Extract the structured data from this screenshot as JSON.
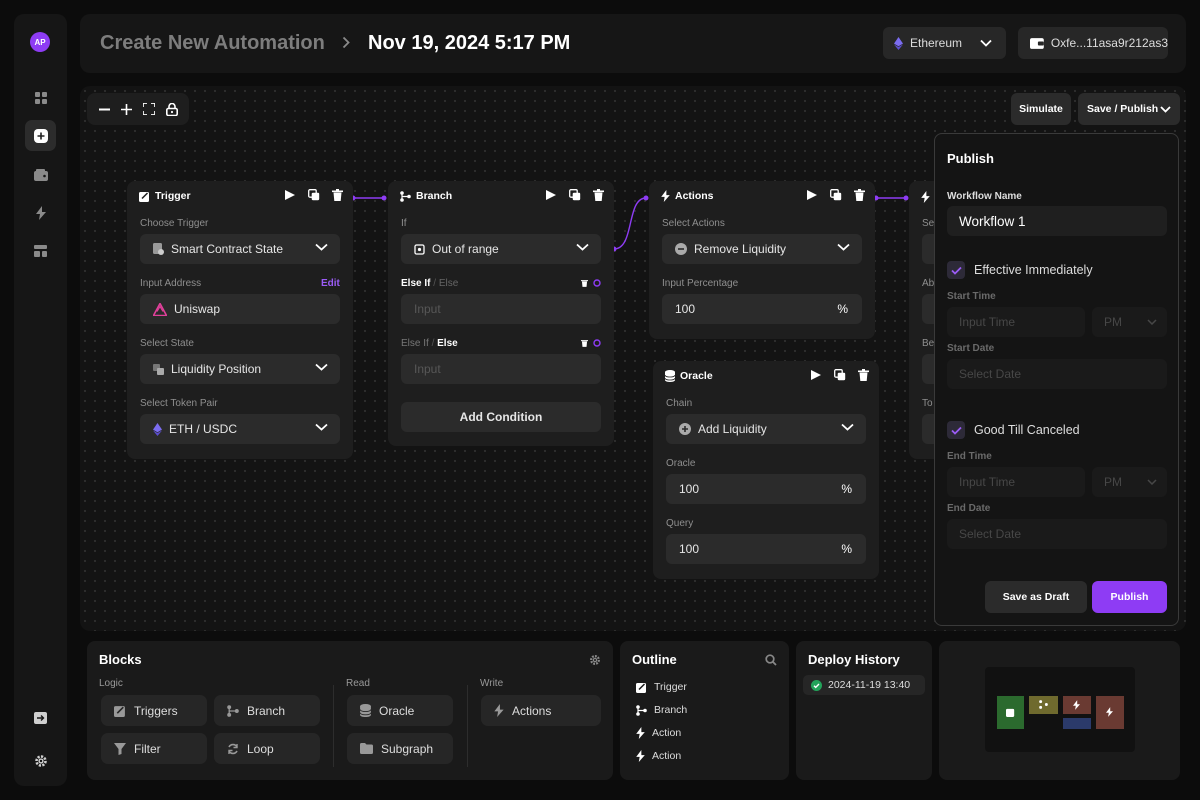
{
  "header": {
    "title": "Create New Automation",
    "subtitle": "Nov 19, 2024 5:17 PM",
    "network": "Ethereum",
    "wallet": "Oxfe...11asa9r212as3"
  },
  "nav": {
    "logo": "AP",
    "items": [
      "grid-icon",
      "add-icon",
      "wallet-icon",
      "bolt-icon",
      "layout-icon"
    ],
    "bottom": [
      "exit-icon",
      "settings-icon"
    ]
  },
  "canvas": {
    "simulate": "Simulate",
    "save_publish": "Save / Publish"
  },
  "nodes": {
    "trigger": {
      "title": "Trigger",
      "choose_trigger_label": "Choose Trigger",
      "choose_trigger_value": "Smart Contract State",
      "input_address_label": "Input Address",
      "edit": "Edit",
      "address": "Uniswap",
      "select_state_label": "Select State",
      "state": "Liquidity Position",
      "token_pair_label": "Select Token Pair",
      "token_pair": "ETH / USDC"
    },
    "branch": {
      "title": "Branch",
      "if_label": "If",
      "if_value": "Out of range",
      "elseif_label": "Else If",
      "else_muted": "Else",
      "input_ph": "Input",
      "elseif2_muted": "Else If",
      "else_label": "Else",
      "add_condition": "Add Condition"
    },
    "actions": {
      "title": "Actions",
      "select_label": "Select Actions",
      "select_value": "Remove Liquidity",
      "pct_label": "Input Percentage",
      "pct_value": "100",
      "pct": "%"
    },
    "oracle": {
      "title": "Oracle",
      "chain_label": "Chain",
      "chain_value": "Add Liquidity",
      "oracle_label": "Oracle",
      "oracle_value": "100",
      "query_label": "Query",
      "query_value": "100",
      "pct": "%"
    },
    "partial": {
      "l1": "Se",
      "l2": "Ab",
      "l3": "Be",
      "l4": "To"
    }
  },
  "publish": {
    "title": "Publish",
    "wf_label": "Workflow Name",
    "wf_value": "Workflow 1",
    "effective": "Effective Immediately",
    "start_time": "Start Time",
    "input_time": "Input Time",
    "pm": "PM",
    "start_date": "Start Date",
    "select_date": "Select Date",
    "gtc": "Good Till Canceled",
    "end_time": "End Time",
    "end_date": "End Date",
    "save_draft": "Save as Draft",
    "publish": "Publish",
    "accent": "#8e3cf4"
  },
  "blocks": {
    "title": "Blocks",
    "logic": "Logic",
    "read": "Read",
    "write": "Write",
    "items": {
      "triggers": "Triggers",
      "branch": "Branch",
      "filter": "Filter",
      "loop": "Loop",
      "oracle": "Oracle",
      "subgraph": "Subgraph",
      "actions": "Actions"
    }
  },
  "outline": {
    "title": "Outline",
    "items": [
      "Trigger",
      "Branch",
      "Action",
      "Action"
    ]
  },
  "deploy": {
    "title": "Deploy History",
    "entry": "2024-11-19 13:40",
    "status_color": "#22a35a"
  }
}
